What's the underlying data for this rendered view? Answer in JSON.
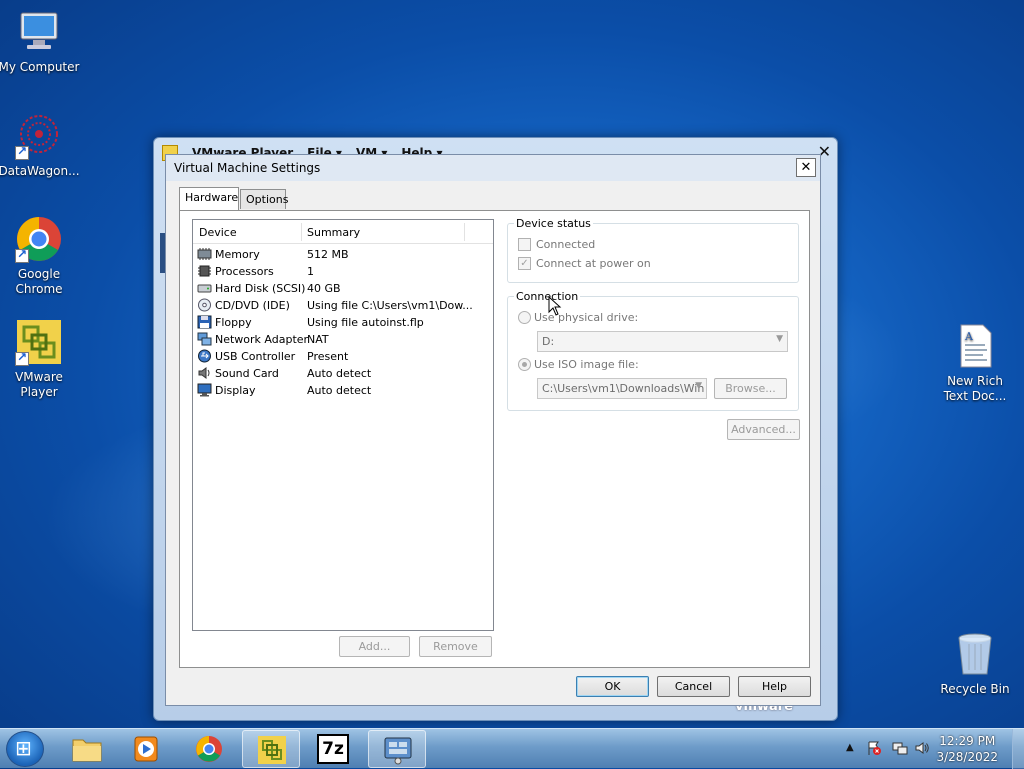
{
  "desktop": {
    "icons": [
      {
        "label": "My Computer"
      },
      {
        "label": "DataWagon..."
      },
      {
        "label": "Google\nChrome"
      },
      {
        "label": "VMware\nPlayer"
      },
      {
        "label": "New Rich\nText Doc..."
      },
      {
        "label": "Recycle Bin"
      }
    ]
  },
  "player": {
    "title": "VMware Player",
    "menus": [
      "File",
      "VM",
      "Help"
    ],
    "brand": "vmware"
  },
  "dialog": {
    "title": "Virtual Machine Settings",
    "close": "✕",
    "tabs": [
      {
        "label": "Hardware"
      },
      {
        "label": "Options"
      }
    ],
    "device_list": {
      "columns": [
        "Device",
        "Summary"
      ],
      "rows": [
        {
          "device": "Memory",
          "summary": "512 MB",
          "icon": "memory-icon"
        },
        {
          "device": "Processors",
          "summary": "1",
          "icon": "processor-icon"
        },
        {
          "device": "Hard Disk (SCSI)",
          "summary": "40 GB",
          "icon": "hard-disk-icon"
        },
        {
          "device": "CD/DVD (IDE)",
          "summary": "Using file C:\\Users\\vm1\\Dow...",
          "icon": "cd-dvd-icon"
        },
        {
          "device": "Floppy",
          "summary": "Using file autoinst.flp",
          "icon": "floppy-icon"
        },
        {
          "device": "Network Adapter",
          "summary": "NAT",
          "icon": "network-adapter-icon"
        },
        {
          "device": "USB Controller",
          "summary": "Present",
          "icon": "usb-icon"
        },
        {
          "device": "Sound Card",
          "summary": "Auto detect",
          "icon": "sound-card-icon"
        },
        {
          "device": "Display",
          "summary": "Auto detect",
          "icon": "display-icon"
        }
      ]
    },
    "add_label": "Add...",
    "remove_label": "Remove",
    "device_status": {
      "title": "Device status",
      "connected_label": "Connected",
      "connected": false,
      "connect_power_label": "Connect at power on",
      "connect_power": true
    },
    "connection": {
      "title": "Connection",
      "physical_label": "Use physical drive:",
      "physical_drive": "D:",
      "iso_label": "Use ISO image file:",
      "iso_path": "C:\\Users\\vm1\\Downloads\\Win",
      "browse_label": "Browse...",
      "selected": "iso"
    },
    "advanced_label": "Advanced...",
    "ok_label": "OK",
    "cancel_label": "Cancel",
    "help_label": "Help"
  },
  "taskbar": {
    "start_glyph": "⊞",
    "apps": [
      {
        "name": "explorer",
        "icon": "folder-icon"
      },
      {
        "name": "media-player",
        "icon": "media-player-icon"
      },
      {
        "name": "chrome",
        "icon": "chrome-icon"
      },
      {
        "name": "vmware-player",
        "icon": "vmware-icon",
        "active": true
      },
      {
        "name": "7zip",
        "icon": "7zip-icon",
        "label": "7z"
      },
      {
        "name": "vm-settings",
        "icon": "settings-icon",
        "active": true
      }
    ],
    "tray": {
      "chevron": "▲"
    },
    "time": "12:29 PM",
    "date": "3/28/2022"
  },
  "colors": {
    "accent": "#1668c8",
    "vmware_yellow": "#f1d14a"
  }
}
